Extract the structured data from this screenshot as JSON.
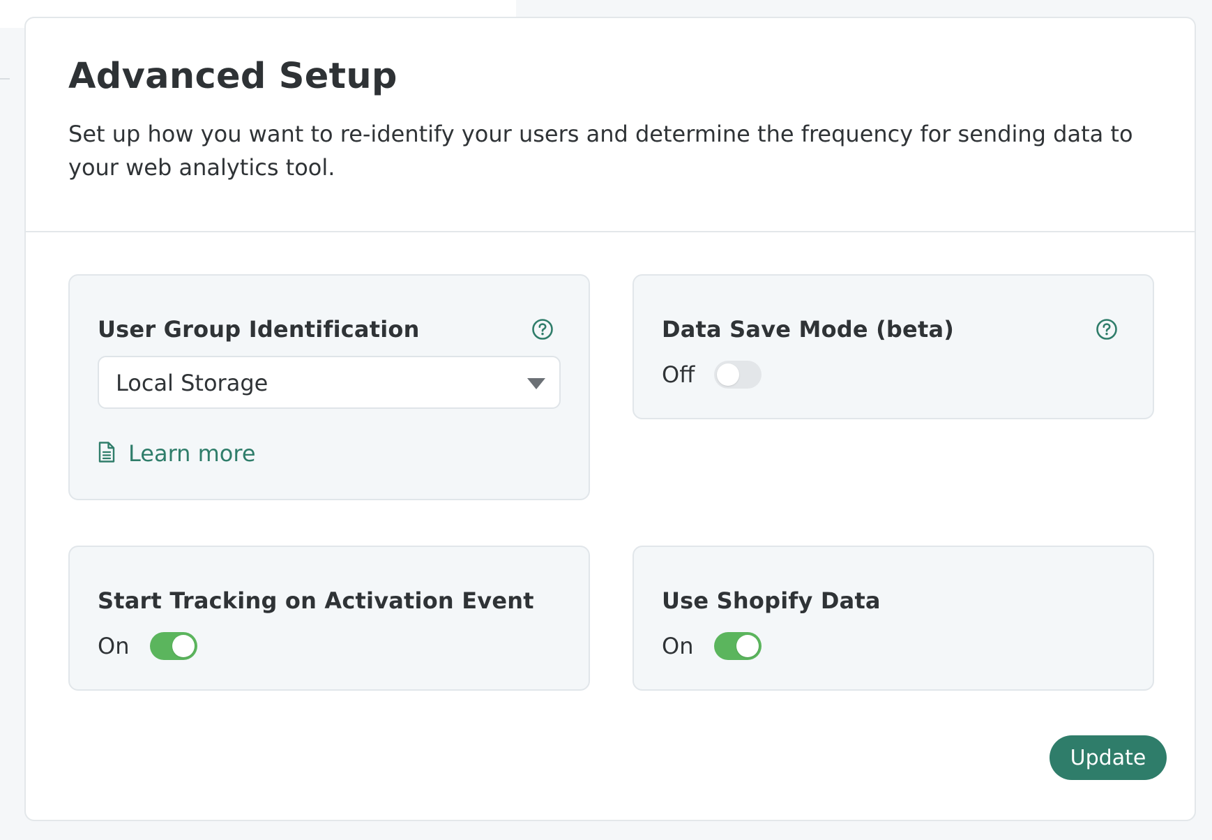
{
  "header": {
    "title": "Advanced Setup",
    "description": "Set up how you want to re-identify your users and determine the frequency for sending data to your web analytics tool."
  },
  "panels": {
    "user_group": {
      "title": "User Group Identification",
      "selected": "Local Storage",
      "learn_more": "Learn more"
    },
    "data_save": {
      "title": "Data Save Mode (beta)",
      "state_label": "Off",
      "enabled": false
    },
    "start_tracking": {
      "title": "Start Tracking on Activation Event",
      "state_label": "On",
      "enabled": true
    },
    "shopify": {
      "title": "Use Shopify Data",
      "state_label": "On",
      "enabled": true
    }
  },
  "actions": {
    "update_label": "Update"
  },
  "colors": {
    "accent": "#2f7d6a",
    "toggle_on": "#5bb55d",
    "toggle_off": "#e3e6e9"
  }
}
